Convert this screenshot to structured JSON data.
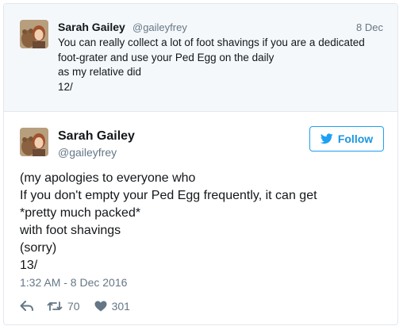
{
  "parent_tweet": {
    "author_name": "Sarah Gailey",
    "author_handle": "@gaileyfrey",
    "date": "8 Dec",
    "lines": [
      "You can really collect a lot of foot shavings if you are a dedicated",
      "foot-grater and use your Ped Egg on the daily",
      "as my relative did",
      "12/"
    ]
  },
  "main_tweet": {
    "author_name": "Sarah Gailey",
    "author_handle": "@gaileyfrey",
    "follow_label": "Follow",
    "lines": [
      "(my apologies to everyone who",
      "If you don't empty your Ped Egg frequently, it can get",
      "*pretty much packed*",
      "with foot shavings",
      "(sorry)",
      "13/"
    ],
    "timestamp": "1:32 AM - 8 Dec 2016",
    "retweet_count": "70",
    "like_count": "301"
  },
  "icons": {
    "reply": "reply-icon",
    "retweet": "retweet-icon",
    "like": "heart-icon",
    "follow": "twitter-bird-icon"
  },
  "colors": {
    "accent": "#1da1f2",
    "follow_text": "#1b95e0",
    "muted": "#657786",
    "parent_bg": "#f5f8fa",
    "border": "#e1e8ed"
  }
}
